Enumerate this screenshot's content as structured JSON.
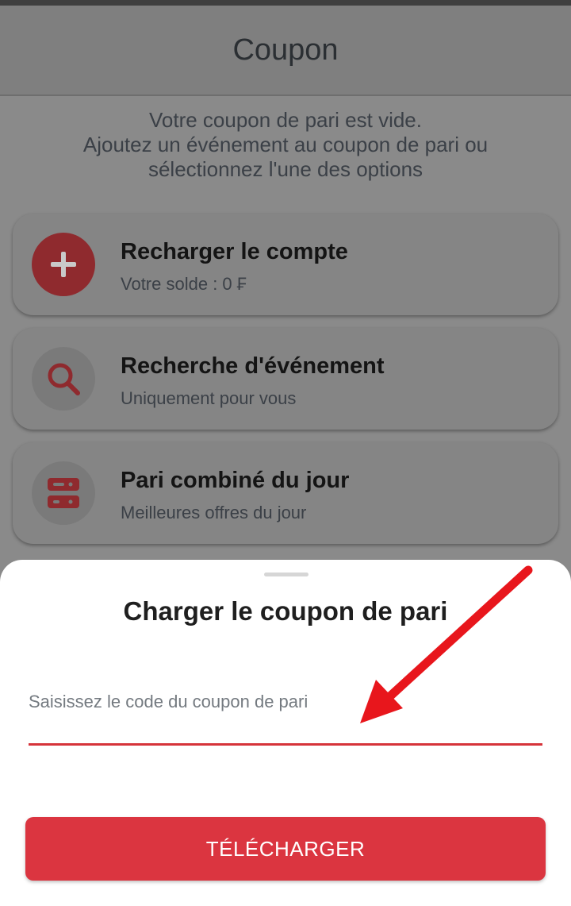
{
  "header": {
    "title": "Coupon"
  },
  "empty_message": {
    "line1": "Votre coupon de pari est vide.",
    "line2": "Ajoutez un événement au coupon de pari ou",
    "line3": "sélectionnez l'une des options"
  },
  "cards": [
    {
      "title": "Recharger le compte",
      "subtitle": "Votre solde : 0 ₣",
      "icon": "plus-icon"
    },
    {
      "title": "Recherche d'événement",
      "subtitle": "Uniquement pour vous",
      "icon": "search-icon"
    },
    {
      "title": "Pari combiné du jour",
      "subtitle": "Meilleures offres du jour",
      "icon": "combo-bet-icon"
    }
  ],
  "sheet": {
    "title": "Charger le coupon de pari",
    "input_placeholder": "Saisissez le code du coupon de pari",
    "input_value": "",
    "button_label": "TÉLÉCHARGER"
  },
  "colors": {
    "accent": "#db3540",
    "overlay": "#8a8a8a",
    "annotation_arrow": "#e8161c"
  }
}
